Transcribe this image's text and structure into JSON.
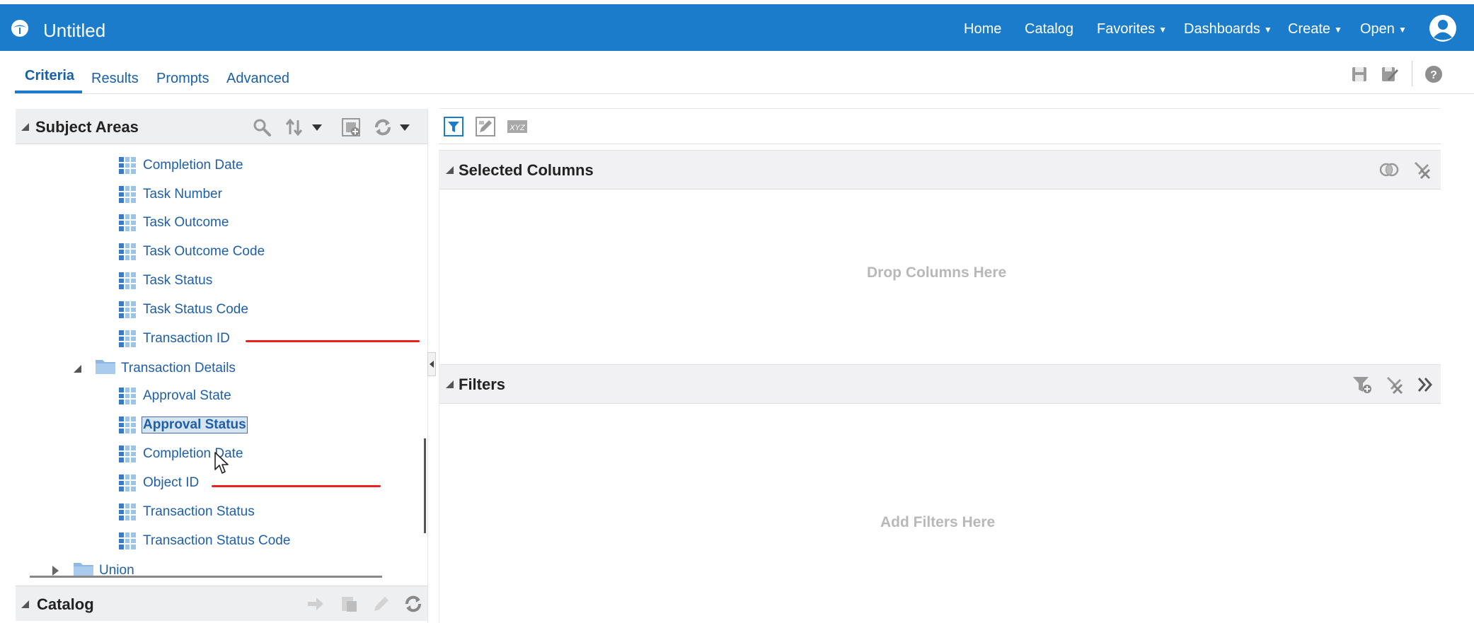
{
  "header": {
    "app_title": "Untitled",
    "nav": [
      {
        "label": "Home",
        "dropdown": false
      },
      {
        "label": "Catalog",
        "dropdown": false
      },
      {
        "label": "Favorites",
        "dropdown": true
      },
      {
        "label": "Dashboards",
        "dropdown": true
      },
      {
        "label": "Create",
        "dropdown": true
      },
      {
        "label": "Open",
        "dropdown": true
      }
    ],
    "bar_color": "#1b7ccc"
  },
  "tabs": [
    {
      "label": "Criteria",
      "active": true
    },
    {
      "label": "Results",
      "active": false
    },
    {
      "label": "Prompts",
      "active": false
    },
    {
      "label": "Advanced",
      "active": false
    }
  ],
  "subject_areas": {
    "title": "Subject Areas",
    "items": [
      {
        "type": "column",
        "label": "Completion Date"
      },
      {
        "type": "column",
        "label": "Task Number"
      },
      {
        "type": "column",
        "label": "Task Outcome"
      },
      {
        "type": "column",
        "label": "Task Outcome Code"
      },
      {
        "type": "column",
        "label": "Task Status"
      },
      {
        "type": "column",
        "label": "Task Status Code"
      },
      {
        "type": "column",
        "label": "Transaction ID"
      },
      {
        "type": "folder",
        "label": "Transaction Details",
        "expanded": true
      },
      {
        "type": "column",
        "label": "Approval State"
      },
      {
        "type": "column",
        "label": "Approval Status",
        "selected": true
      },
      {
        "type": "column",
        "label": "Completion Date"
      },
      {
        "type": "column",
        "label": "Object ID"
      },
      {
        "type": "column",
        "label": "Transaction Status"
      },
      {
        "type": "column",
        "label": "Transaction Status Code"
      },
      {
        "type": "folder",
        "label": "Union",
        "expanded": false
      }
    ]
  },
  "catalog": {
    "title": "Catalog"
  },
  "selected_columns": {
    "title": "Selected Columns",
    "placeholder": "Drop Columns Here"
  },
  "filters": {
    "title": "Filters",
    "placeholder": "Add Filters Here"
  },
  "annotation_color": "#e8231f"
}
